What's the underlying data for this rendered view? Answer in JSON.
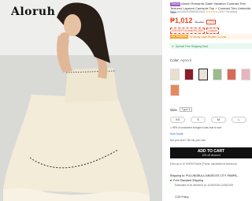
{
  "photo": {
    "brand_logo": "Aloruh"
  },
  "product": {
    "brand_badge": "Trends",
    "title": "Aloruh Romantic Date/ Vacation Contrast Trim Textured Layered Camisole Top + Contrast Trim Umbrella Skirt",
    "sku": "SKU: sz24062198680824415",
    "rating_stars": "★★★★★",
    "review_count": "(100+ Reviews)",
    "price": "₱1,012",
    "original_price": "₱1,393",
    "discount": "-27%",
    "promos": [
      "13% OFF For order ₱1,200+",
      "Coupon"
    ],
    "bestseller_tag": "#12 Bestseller",
    "bestseller_text": "in Trendy Layer Women Co-ords",
    "shipping_text": "Special Free Shipping Deal",
    "color_label": "Color:",
    "color_value": "Apricot",
    "size_label": "Size",
    "size_type": "Type ▾",
    "sizes": [
      "XS",
      "S",
      "M",
      "L"
    ],
    "fit_note": "95% of customers thought it was true to size",
    "size_guide": "Size Guide",
    "size_note": "Not your size? Tell me your size",
    "add_to_cart": "ADD TO CART",
    "add_to_cart_sub": "13% off discount",
    "earn_note": "Earn up to 10 SHEIN Points (Points, calculated at checkout)",
    "ship_to": "Shipping to: PULUNGBULU ANGELES CITY PAMPA...",
    "free_shipping": "Free Standard Shipping",
    "estimated": "Estimated to be delivered on 11/06/2025-12/06/2025",
    "cod": "COD Policy"
  },
  "colors": {
    "accent": "#e24a2b",
    "bestseller": "#f7a531",
    "shipping": "#2e8b57",
    "cart_button": "#111111"
  },
  "swatches": [
    {
      "name": "apricot-black-trim",
      "color": "#eadfcf"
    },
    {
      "name": "burgundy",
      "color": "#8b1e2b"
    },
    {
      "name": "white-selected",
      "color": "#e8e2da"
    },
    {
      "name": "green",
      "color": "#9dbb8f"
    },
    {
      "name": "red-white",
      "color": "#d86a5a"
    },
    {
      "name": "pink",
      "color": "#e7b5c0"
    },
    {
      "name": "orange",
      "color": "#e48a5b"
    }
  ]
}
